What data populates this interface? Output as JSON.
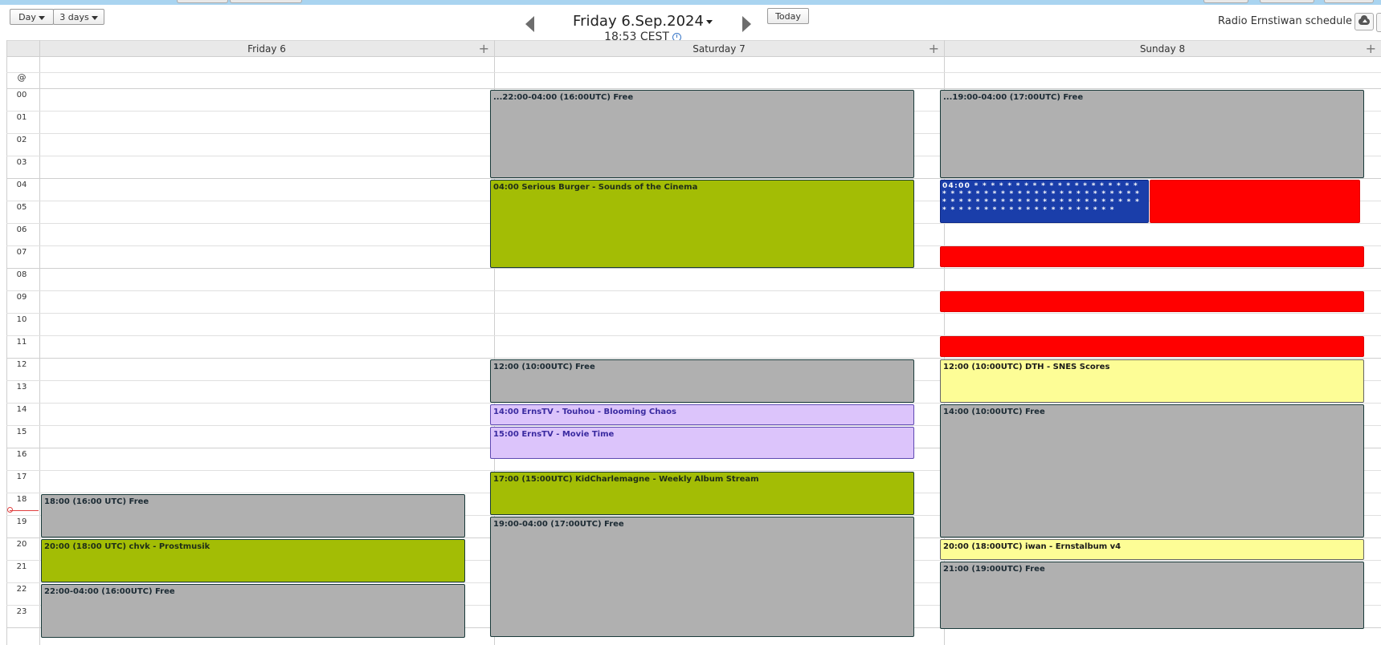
{
  "toolbar": {
    "view_day_label": "Day",
    "view_3days_label": "3 days",
    "date_title": "Friday 6.Sep.2024",
    "current_time": "18:53 CEST",
    "today_label": "Today",
    "schedule_title": "Radio Ernstiwan schedule"
  },
  "days": [
    {
      "label": "Friday 6",
      "add": "+"
    },
    {
      "label": "Saturday 7",
      "add": "+"
    },
    {
      "label": "Sunday 8",
      "add": "+"
    }
  ],
  "allday_label": "@",
  "hours": [
    "00",
    "01",
    "02",
    "03",
    "04",
    "05",
    "06",
    "07",
    "08",
    "09",
    "10",
    "11",
    "12",
    "13",
    "14",
    "15",
    "16",
    "17",
    "18",
    "19",
    "20",
    "21",
    "22",
    "23"
  ],
  "events": {
    "fri_1800": "18:00 (16:00 UTC) Free",
    "fri_2000": "20:00 (18:00 UTC) chvk - Prostmusik",
    "fri_2200": "22:00-04:00 (16:00UTC) Free",
    "sat_0000": "...22:00-04:00 (16:00UTC) Free",
    "sat_0400": "04:00 Serious Burger - Sounds of the Cinema",
    "sat_1200": "12:00 (10:00UTC) Free",
    "sat_1400": "14:00 ErnsTV - Touhou - Blooming Chaos",
    "sat_1500": "15:00 ErnsTV - Movie Time",
    "sat_1700": "17:00 (15:00UTC) KidCharlemagne - Weekly Album Stream",
    "sat_1900": "19:00-04:00 (17:00UTC) Free",
    "sun_0000": "...19:00-04:00 (17:00UTC) Free",
    "sun_0400": "04:00 * * * * * * * * * * * * * * * * * * * * * * * * * * * * * * * * * * * * * * * * * * * * * * * * * * * * * * * * * * * * * * * * * * * * * * * * * * * * * * * * * * * * * * * * *",
    "sun_1200": "12:00 (10:00UTC) DTH - SNES Scores",
    "sun_1400": "14:00 (10:00UTC) Free",
    "sun_2000": "20:00 (18:00UTC) iwan - Ernstalbum v4",
    "sun_2100": "21:00 (19:00UTC) Free"
  },
  "colors": {
    "free": "#b0b0b0",
    "show_green": "#a3bd05",
    "show_lavender": "#dcc4fb",
    "show_yellow": "#fdfd96",
    "stripe_red": "#ff0000",
    "flag_blue": "#1a3eaa"
  }
}
